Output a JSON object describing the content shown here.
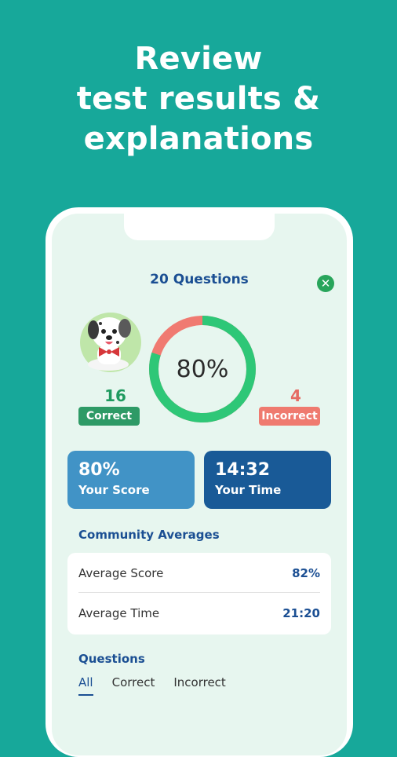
{
  "headline": [
    "Review",
    "test results &",
    "explanations"
  ],
  "quiz": {
    "title": "20 Questions",
    "close_icon": "close-icon",
    "score_percent": 80,
    "score_label": "80%",
    "correct_count": "16",
    "correct_label": "Correct",
    "incorrect_count": "4",
    "incorrect_label": "Incorrect"
  },
  "cards": {
    "score_value": "80%",
    "score_label": "Your Score",
    "time_value": "14:32",
    "time_label": "Your Time"
  },
  "community": {
    "title": "Community Averages",
    "rows": [
      {
        "label": "Average Score",
        "value": "82%"
      },
      {
        "label": "Average Time",
        "value": "21:20"
      }
    ]
  },
  "questions": {
    "title": "Questions",
    "tabs": [
      "All",
      "Correct",
      "Incorrect"
    ]
  },
  "colors": {
    "background": "#17a89a",
    "correct": "#2e9a66",
    "incorrect": "#ef7a6f",
    "score_card": "#4193c6",
    "time_card": "#195a97",
    "accent": "#1b4f93"
  }
}
